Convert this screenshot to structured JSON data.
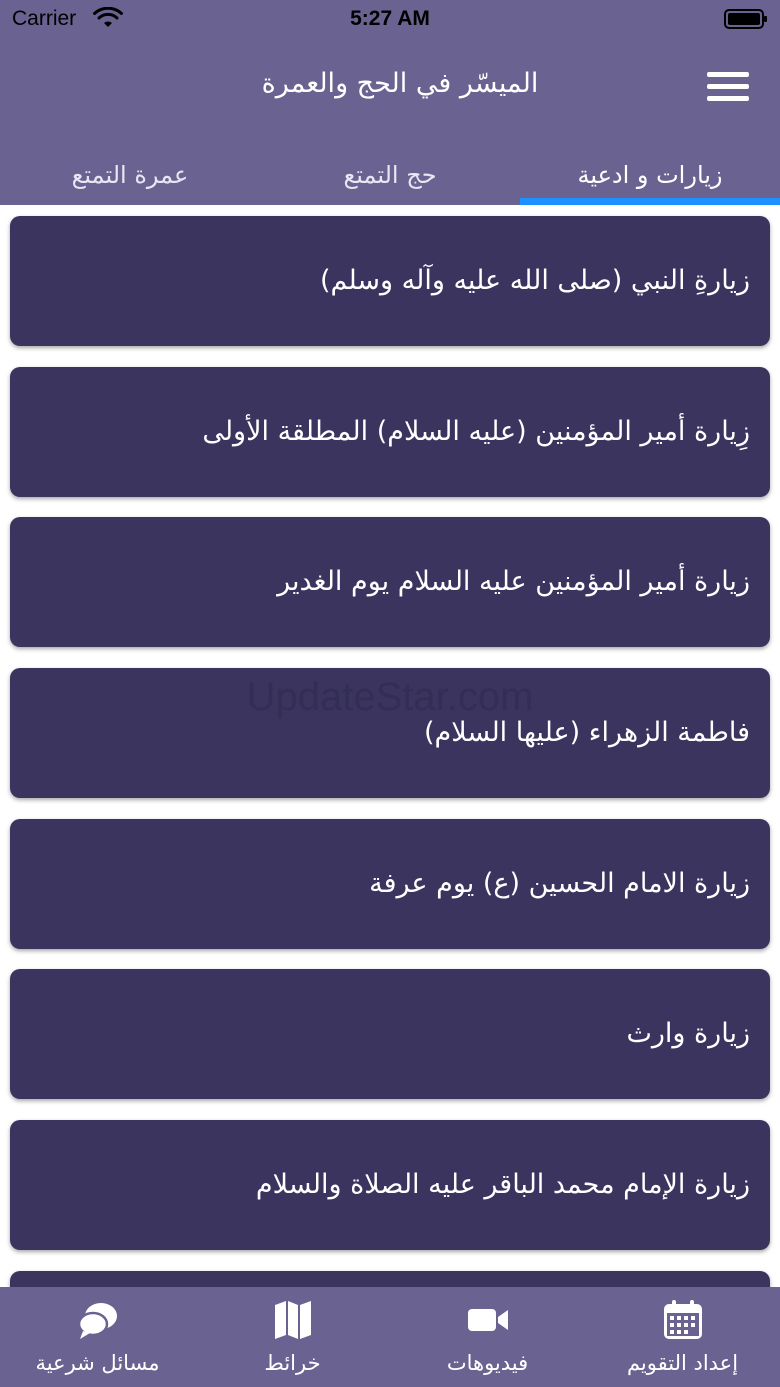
{
  "status_bar": {
    "carrier": "Carrier",
    "time": "5:27 AM"
  },
  "header": {
    "title": "الميسّر في الحج والعمرة"
  },
  "tabs": [
    {
      "label": "زيارات و ادعية",
      "active": true
    },
    {
      "label": "حج التمتع",
      "active": false
    },
    {
      "label": "عمرة التمتع",
      "active": false
    }
  ],
  "items": [
    {
      "label": "زيارةِ النبي (صلى الله عليه وآله وسلم)"
    },
    {
      "label": "زِيارة أمير المؤمنين (عليه السلام) المطلقة الأولى"
    },
    {
      "label": "زيارة أمير المؤمنين عليه السلام يوم الغدير"
    },
    {
      "label": "فاطمة الزهراء (عليها السلام)"
    },
    {
      "label": "زيارة الامام الحسين (ع) يوم عرفة"
    },
    {
      "label": "زيارة وارث"
    },
    {
      "label": "زيارة الإمام محمد الباقر عليه الصلاة والسلام"
    }
  ],
  "watermark": "UpdateStar.com",
  "tabbar": [
    {
      "label": "إعداد التقويم",
      "icon": "calendar-icon"
    },
    {
      "label": "فيديوهات",
      "icon": "video-camera-icon"
    },
    {
      "label": "خرائط",
      "icon": "map-icon"
    },
    {
      "label": "مسائل شرعية",
      "icon": "chat-bubbles-icon"
    }
  ],
  "colors": {
    "header_bg": "#6a6391",
    "card_bg": "#3a345f",
    "tab_indicator": "#1e90ff",
    "text": "#ffffff"
  }
}
